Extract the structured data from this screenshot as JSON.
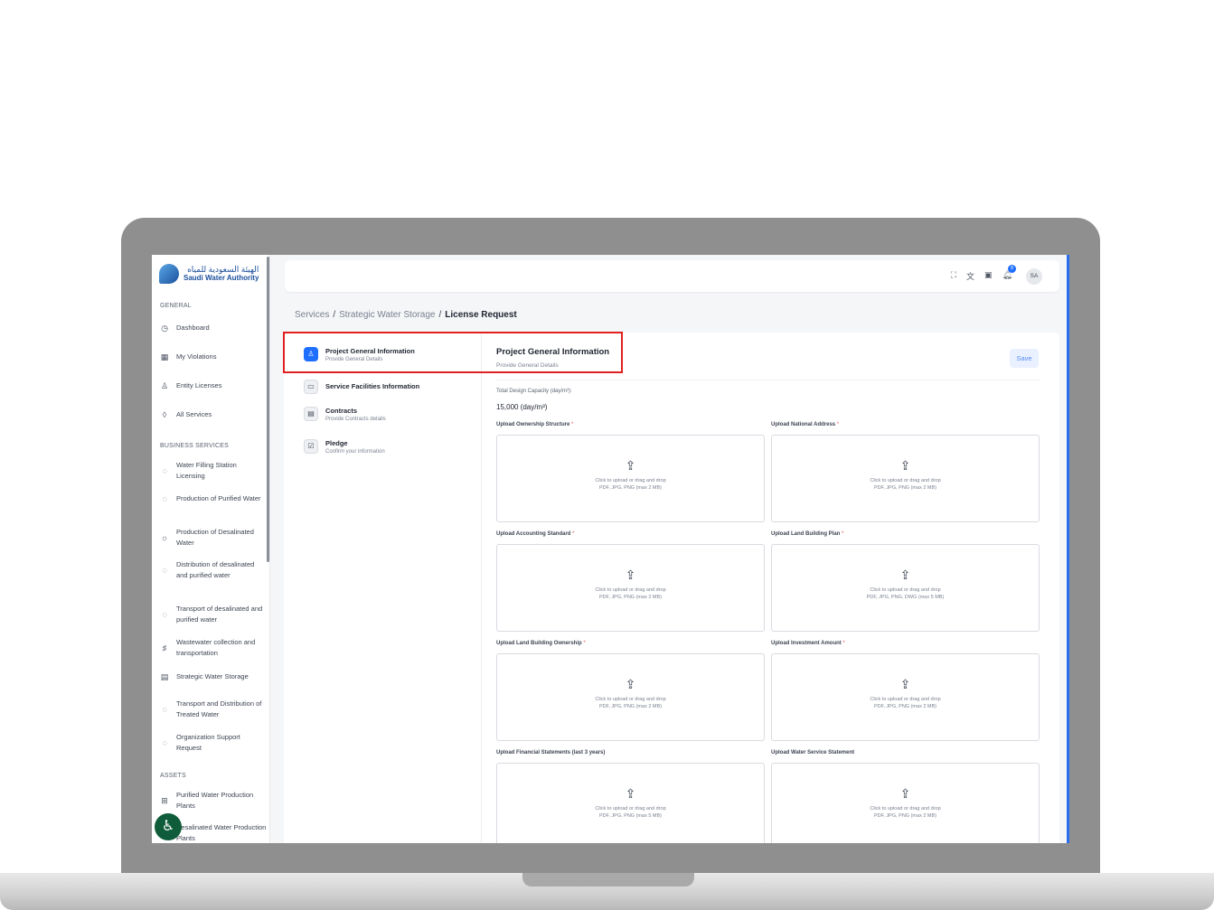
{
  "logo": {
    "arabic": "الهيئة السعودية للمياه",
    "english": "Saudi Water Authority"
  },
  "sidebar": {
    "general_title": "GENERAL",
    "general": [
      {
        "label": "Dashboard",
        "icon": "dashboard-icon"
      },
      {
        "label": "My Violations",
        "icon": "grid-icon"
      },
      {
        "label": "Entity Licenses",
        "icon": "user-icon"
      },
      {
        "label": "All Services",
        "icon": "drop-icon"
      }
    ],
    "business_title": "BUSINESS SERVICES",
    "business": [
      {
        "label": "Water Filling Station Licensing"
      },
      {
        "label": "Production of Purified Water"
      },
      {
        "label": "Production of Desalinated Water"
      },
      {
        "label": "Distribution of desalinated and purified water"
      },
      {
        "label": "Transport of desalinated and purified water"
      },
      {
        "label": "Wastewater collection and transportation"
      },
      {
        "label": "Strategic Water Storage"
      },
      {
        "label": "Transport and Distribution of Treated Water"
      },
      {
        "label": "Organization Support Request"
      }
    ],
    "assets_title": "ASSETS",
    "assets": [
      {
        "label": "Purified Water Production Plants"
      },
      {
        "label": "Desalinated Water Production Plants"
      }
    ]
  },
  "header": {
    "avatar": "SA",
    "notification_count": "8"
  },
  "breadcrumb": {
    "services": "Services",
    "category": "Strategic Water Storage",
    "current": "License Request",
    "sep": "/"
  },
  "steps": [
    {
      "title": "Project General Information",
      "subtitle": "Provide General Details"
    },
    {
      "title": "Service Facilities Information",
      "subtitle": ""
    },
    {
      "title": "Contracts",
      "subtitle": "Provide Contracts details"
    },
    {
      "title": "Pledge",
      "subtitle": "Confirm your information"
    }
  ],
  "form": {
    "title": "Project General Information",
    "subtitle": "Provide General Details",
    "save_label": "Save",
    "capacity_label": "Total Design Capacity (day/m³):",
    "capacity_value": "15,000 (day/m³)",
    "uploads": [
      {
        "label": "Upload Ownership Structure",
        "required": "*",
        "hint": "Click to upload or drag and drop",
        "formats": "PDF, JPG, PNG (max 2 MB)"
      },
      {
        "label": "Upload National Address",
        "required": "*",
        "hint": "Click to upload or drag and drop",
        "formats": "PDF, JPG, PNG (max 2 MB)"
      },
      {
        "label": "Upload Accounting Standard",
        "required": "*",
        "hint": "Click to upload or drag and drop",
        "formats": "PDF, JPG, PNG (max 2 MB)"
      },
      {
        "label": "Upload Land Building Plan",
        "required": "*",
        "hint": "Click to upload or drag and drop",
        "formats": "PDF, JPG, PNG, DWG (max 5 MB)"
      },
      {
        "label": "Upload Land Building Ownership",
        "required": "*",
        "hint": "Click to upload or drag and drop",
        "formats": "PDF, JPG, PNG (max 2 MB)"
      },
      {
        "label": "Upload Investment Amount",
        "required": "*",
        "hint": "Click to upload or drag and drop",
        "formats": "PDF, JPG, PNG (max 2 MB)"
      },
      {
        "label": "Upload Financial Statements (last 3 years)",
        "required": "",
        "hint": "Click to upload or drag and drop",
        "formats": "PDF, JPG, PNG (max 5 MB)"
      },
      {
        "label": "Upload Water Service Statement",
        "required": "",
        "hint": "Click to upload or drag and drop",
        "formats": "PDF, JPG, PNG (max 2 MB)"
      }
    ]
  }
}
